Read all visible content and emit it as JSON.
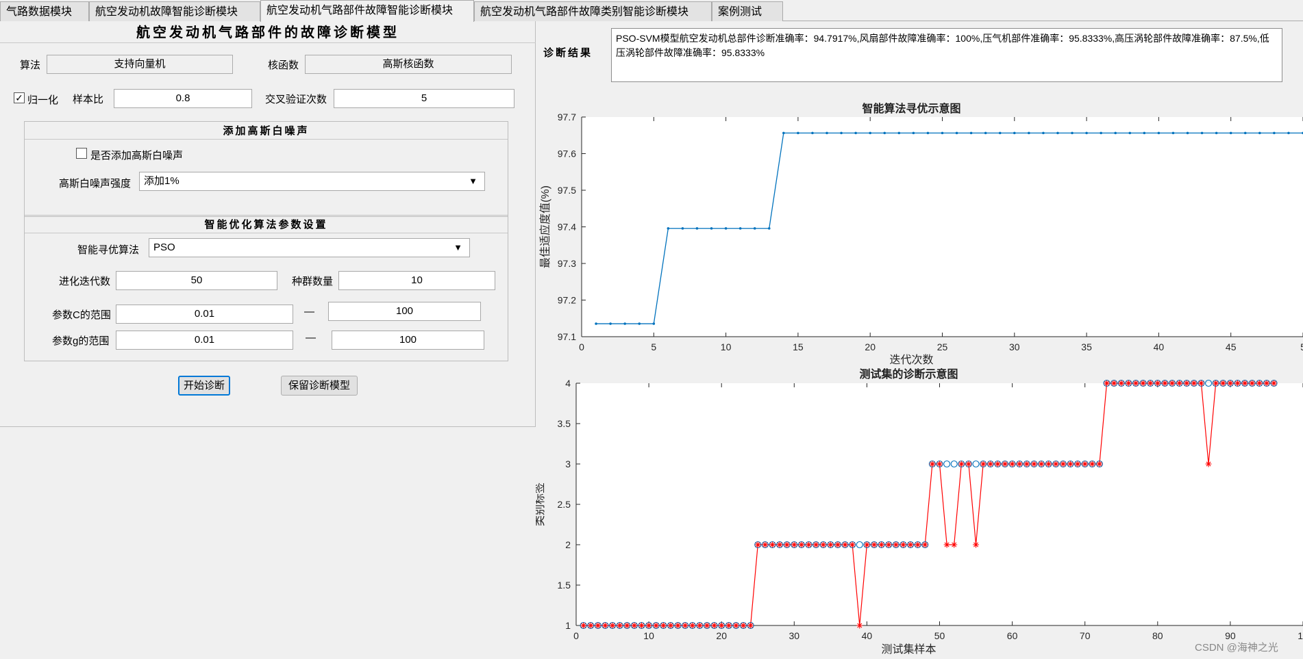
{
  "tabs": [
    {
      "label": "气路数据模块"
    },
    {
      "label": "航空发动机故障智能诊断模块"
    },
    {
      "label": "航空发动机气路部件故障智能诊断模块",
      "active": true
    },
    {
      "label": "航空发动机气路部件故障类别智能诊断模块"
    },
    {
      "label": "案例测试"
    }
  ],
  "panel": {
    "title": "航空发动机气路部件的故障诊断模型",
    "algorithm_label": "算法",
    "algorithm_value": "支持向量机",
    "kernel_label": "核函数",
    "kernel_value": "高斯核函数",
    "normalize_label": "归一化",
    "normalize_checked": "✓",
    "sample_ratio_label": "样本比",
    "sample_ratio_value": "0.8",
    "cv_label": "交叉验证次数",
    "cv_value": "5"
  },
  "noise_group": {
    "title": "添加高斯白噪声",
    "add_noise_label": "是否添加高斯白噪声",
    "strength_label": "高斯白噪声强度",
    "strength_value": "添加1%"
  },
  "opt_group": {
    "title": "智能优化算法参数设置",
    "algo_label": "智能寻优算法",
    "algo_value": "PSO",
    "iter_label": "进化迭代数",
    "iter_value": "50",
    "pop_label": "种群数量",
    "pop_value": "10",
    "c_label": "参数C的范围",
    "c_min": "0.01",
    "c_max": "100",
    "g_label": "参数g的范围",
    "g_min": "0.01",
    "g_max": "100",
    "dash": "—"
  },
  "buttons": {
    "start": "开始诊断",
    "save": "保留诊断模型"
  },
  "result": {
    "label": "诊断结果",
    "text": "PSO-SVM模型航空发动机总部件诊断准确率：94.7917%,风扇部件故障准确率：100%,压气机部件准确率：95.8333%,高压涡轮部件故障准确率：87.5%,低压涡轮部件故障准确率：95.8333%"
  },
  "icons": {
    "dropdown": "▼"
  },
  "colors": {
    "line_blue": "#0072bd",
    "line_red": "#ff0000",
    "marker_blue": "#0072bd"
  },
  "watermark": "CSDN @海神之光",
  "chart_data": [
    {
      "type": "line",
      "title": "智能算法寻优示意图",
      "xlabel": "迭代次数",
      "ylabel": "最佳适应度值(%)",
      "xlim": [
        0,
        50
      ],
      "ylim": [
        97.1,
        97.7
      ],
      "xticks": [
        0,
        5,
        10,
        15,
        20,
        25,
        30,
        35,
        40,
        45,
        "5"
      ],
      "yticks": [
        97.1,
        97.2,
        97.3,
        97.4,
        97.5,
        97.6,
        97.7
      ],
      "x": [
        1,
        2,
        3,
        4,
        5,
        6,
        7,
        8,
        9,
        10,
        11,
        12,
        13,
        14,
        15,
        16,
        17,
        18,
        19,
        20,
        21,
        22,
        23,
        24,
        25,
        26,
        27,
        28,
        29,
        30,
        31,
        32,
        33,
        34,
        35,
        36,
        37,
        38,
        39,
        40,
        41,
        42,
        43,
        44,
        45,
        46,
        47,
        48,
        49,
        50
      ],
      "values": [
        97.1354,
        97.1354,
        97.1354,
        97.1354,
        97.1354,
        97.3958,
        97.3958,
        97.3958,
        97.3958,
        97.3958,
        97.3958,
        97.3958,
        97.3958,
        97.6563,
        97.6563,
        97.6563,
        97.6563,
        97.6563,
        97.6563,
        97.6563,
        97.6563,
        97.6563,
        97.6563,
        97.6563,
        97.6563,
        97.6563,
        97.6563,
        97.6563,
        97.6563,
        97.6563,
        97.6563,
        97.6563,
        97.6563,
        97.6563,
        97.6563,
        97.6563,
        97.6563,
        97.6563,
        97.6563,
        97.6563,
        97.6563,
        97.6563,
        97.6563,
        97.6563,
        97.6563,
        97.6563,
        97.6563,
        97.6563,
        97.6563,
        97.6563
      ],
      "grid": false
    },
    {
      "type": "line",
      "title": "测试集的诊断示意图",
      "xlabel": "测试集样本",
      "ylabel": "类别标签",
      "xlim": [
        0,
        100
      ],
      "ylim": [
        1,
        4
      ],
      "xticks": [
        0,
        10,
        20,
        30,
        40,
        50,
        60,
        70,
        80,
        90,
        "10"
      ],
      "yticks": [
        1,
        1.5,
        2,
        2.5,
        3,
        3.5,
        4
      ],
      "grid": false,
      "series": [
        {
          "marker": "o",
          "values": [
            1,
            1,
            1,
            1,
            1,
            1,
            1,
            1,
            1,
            1,
            1,
            1,
            1,
            1,
            1,
            1,
            1,
            1,
            1,
            1,
            1,
            1,
            1,
            1,
            2,
            2,
            2,
            2,
            2,
            2,
            2,
            2,
            2,
            2,
            2,
            2,
            2,
            2,
            2,
            2,
            2,
            2,
            2,
            2,
            2,
            2,
            2,
            2,
            3,
            3,
            3,
            3,
            3,
            3,
            3,
            3,
            3,
            3,
            3,
            3,
            3,
            3,
            3,
            3,
            3,
            3,
            3,
            3,
            3,
            3,
            3,
            3,
            4,
            4,
            4,
            4,
            4,
            4,
            4,
            4,
            4,
            4,
            4,
            4,
            4,
            4,
            4,
            4,
            4,
            4,
            4,
            4,
            4,
            4,
            4,
            4
          ]
        },
        {
          "marker": "*",
          "values": [
            1,
            1,
            1,
            1,
            1,
            1,
            1,
            1,
            1,
            1,
            1,
            1,
            1,
            1,
            1,
            1,
            1,
            1,
            1,
            1,
            1,
            1,
            1,
            1,
            2,
            2,
            2,
            2,
            2,
            2,
            2,
            2,
            2,
            2,
            2,
            2,
            2,
            2,
            1,
            2,
            2,
            2,
            2,
            2,
            2,
            2,
            2,
            2,
            3,
            3,
            2,
            2,
            3,
            3,
            2,
            3,
            3,
            3,
            3,
            3,
            3,
            3,
            3,
            3,
            3,
            3,
            3,
            3,
            3,
            3,
            3,
            3,
            4,
            4,
            4,
            4,
            4,
            4,
            4,
            4,
            4,
            4,
            4,
            4,
            4,
            4,
            3,
            4,
            4,
            4,
            4,
            4,
            4,
            4,
            4,
            4
          ]
        }
      ]
    }
  ]
}
